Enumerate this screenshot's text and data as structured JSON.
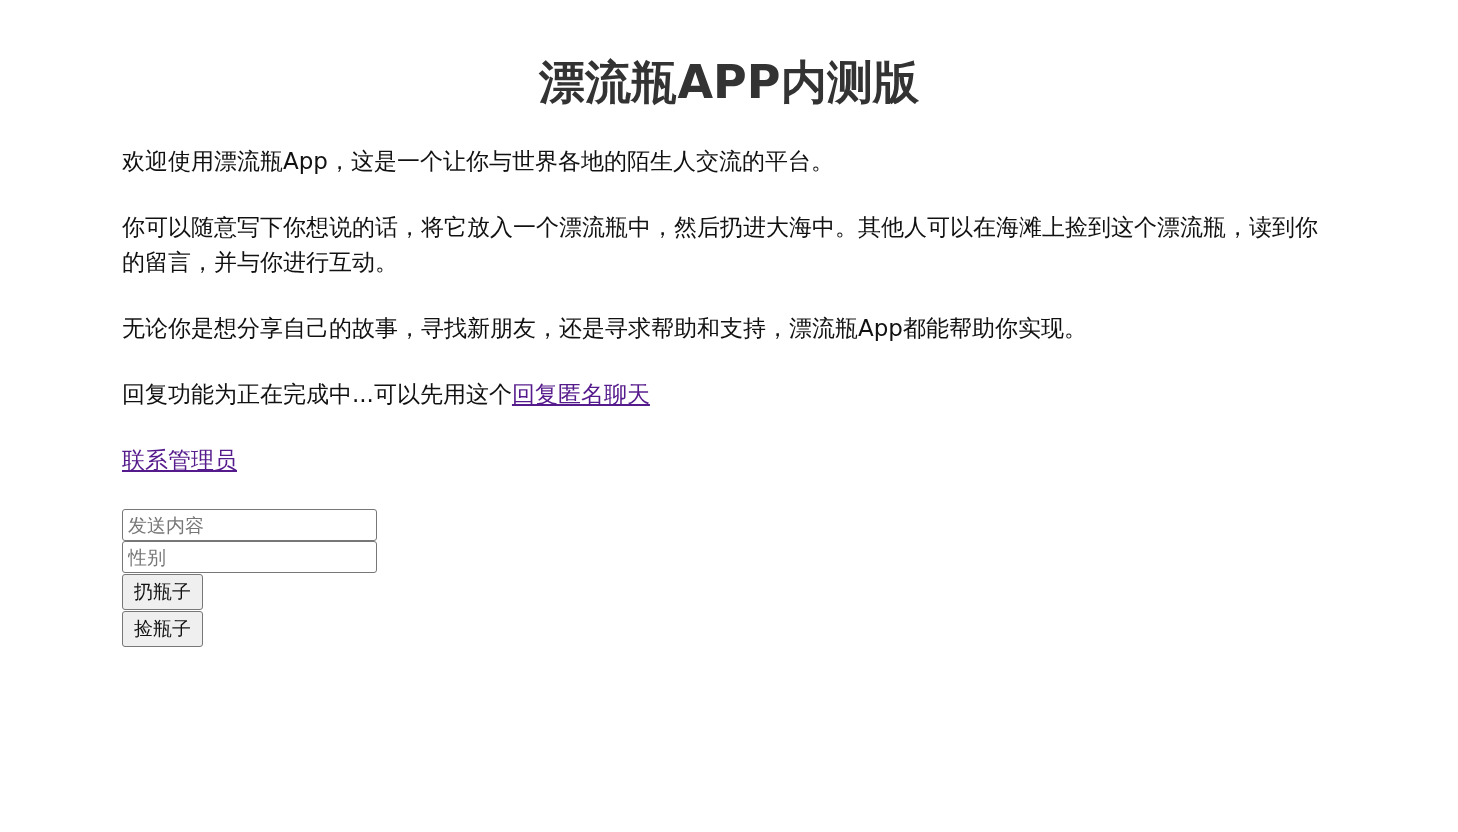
{
  "title": "漂流瓶APP内测版",
  "paragraphs": [
    "欢迎使用漂流瓶App，这是一个让你与世界各地的陌生人交流的平台。",
    "你可以随意写下你想说的话，将它放入一个漂流瓶中，然后扔进大海中。其他人可以在海滩上捡到这个漂流瓶，读到你的留言，并与你进行互动。",
    "无论你是想分享自己的故事，寻找新朋友，还是寻求帮助和支持，漂流瓶App都能帮助你实现。"
  ],
  "notice": {
    "text": "回复功能为正在完成中...可以先用这个",
    "link": "回复匿名聊天"
  },
  "contact_link": "联系管理员",
  "fields": [
    {
      "placeholder": "发送内容"
    },
    {
      "placeholder": "性别"
    }
  ],
  "buttons": [
    "扔瓶子",
    "捡瓶子"
  ]
}
